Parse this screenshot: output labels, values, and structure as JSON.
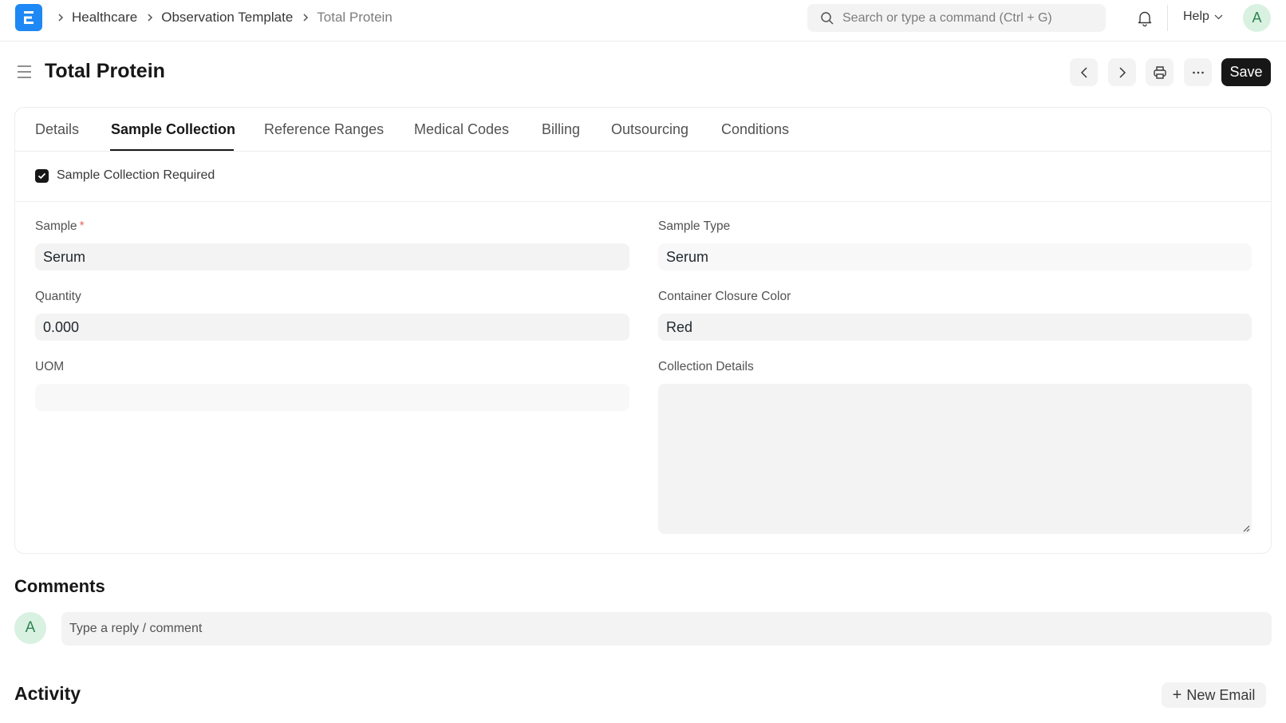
{
  "navbar": {
    "breadcrumbs": [
      "Healthcare",
      "Observation Template",
      "Total Protein"
    ],
    "search_placeholder": "Search or type a command (Ctrl + G)",
    "help_label": "Help",
    "avatar_initial": "A"
  },
  "page": {
    "title": "Total Protein",
    "save_label": "Save"
  },
  "tabs": [
    {
      "label": "Details",
      "active": false
    },
    {
      "label": "Sample Collection",
      "active": true
    },
    {
      "label": "Reference Ranges",
      "active": false
    },
    {
      "label": "Medical Codes",
      "active": false
    },
    {
      "label": "Billing",
      "active": false
    },
    {
      "label": "Outsourcing",
      "active": false
    },
    {
      "label": "Conditions",
      "active": false
    }
  ],
  "form": {
    "sample_collection_required": {
      "label": "Sample Collection Required",
      "checked": true
    },
    "sample": {
      "label": "Sample",
      "required_mark": "*",
      "value": "Serum"
    },
    "quantity": {
      "label": "Quantity",
      "value": "0.000"
    },
    "uom": {
      "label": "UOM",
      "value": ""
    },
    "sample_type": {
      "label": "Sample Type",
      "value": "Serum"
    },
    "container_closure_color": {
      "label": "Container Closure Color",
      "value": "Red"
    },
    "collection_details": {
      "label": "Collection Details",
      "value": ""
    }
  },
  "comments": {
    "title": "Comments",
    "avatar_initial": "A",
    "placeholder": "Type a reply / comment"
  },
  "activity": {
    "title": "Activity",
    "new_email_label": "New Email"
  },
  "colors": {
    "brand": "#1e88f5",
    "primary_button": "#171717",
    "avatar_bg": "#d9f1e1",
    "avatar_text": "#2f8452",
    "required": "#e36a6a"
  }
}
